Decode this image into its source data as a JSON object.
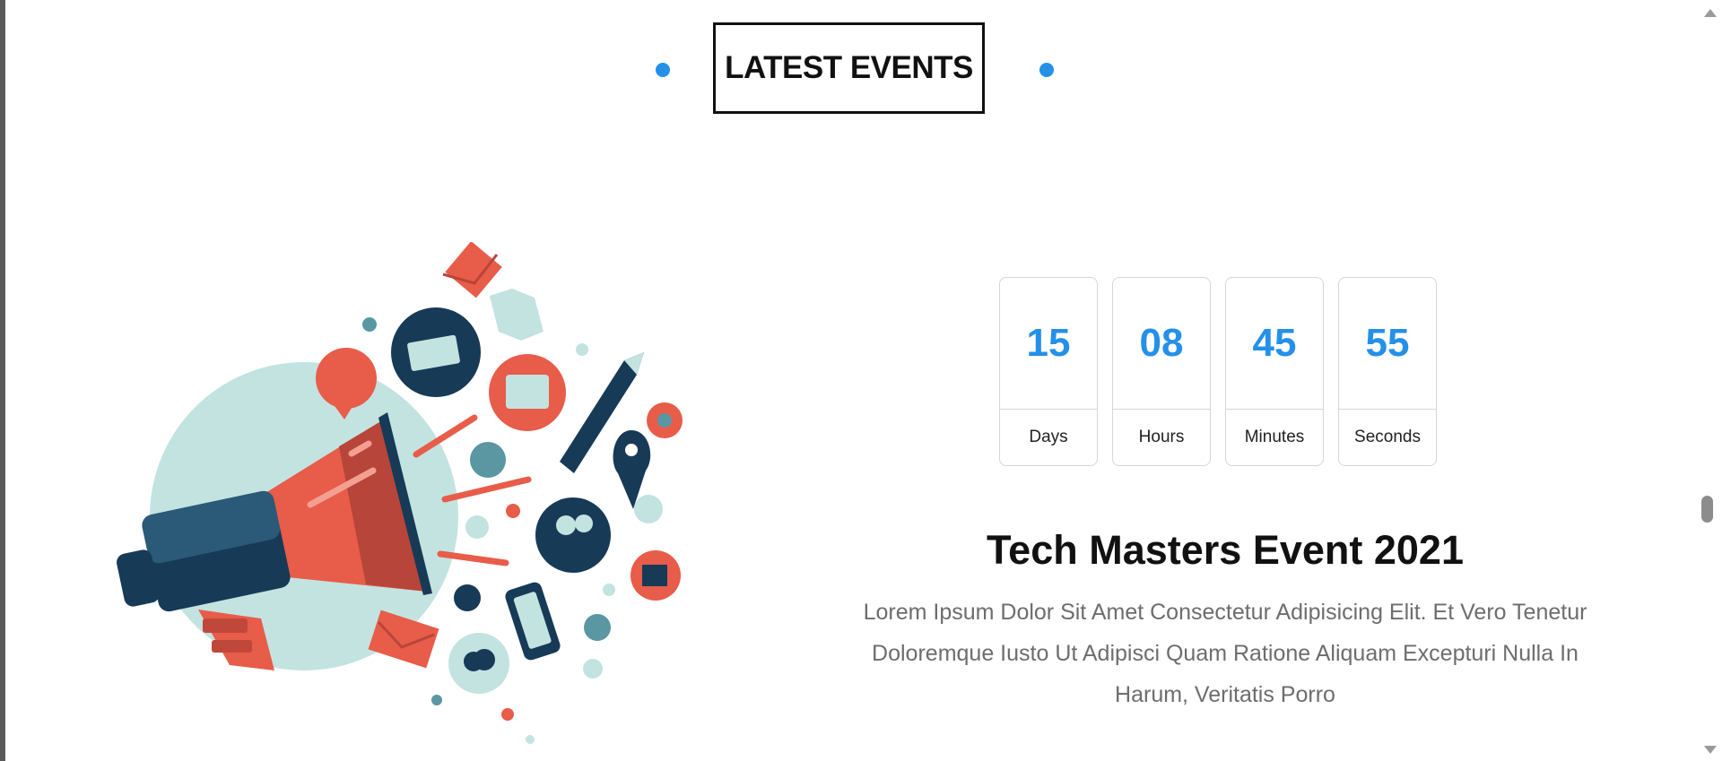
{
  "section": {
    "title": "LATEST EVENTS"
  },
  "countdown": [
    {
      "value": "15",
      "label": "Days"
    },
    {
      "value": "08",
      "label": "Hours"
    },
    {
      "value": "45",
      "label": "Minutes"
    },
    {
      "value": "55",
      "label": "Seconds"
    }
  ],
  "event": {
    "title": "Tech Masters Event 2021",
    "description": "Lorem Ipsum Dolor Sit Amet Consectetur Adipisicing Elit. Et Vero Tenetur Doloremque Iusto Ut Adipisci Quam Ratione Aliquam Excepturi Nulla In Harum, Veritatis Porro"
  },
  "illustration": {
    "icon": "megaphone-marketing-illustration"
  },
  "colors": {
    "accent": "#2490e8",
    "megaphone_red": "#e85c4a",
    "navy": "#173a57",
    "mint": "#c3e3e1"
  }
}
